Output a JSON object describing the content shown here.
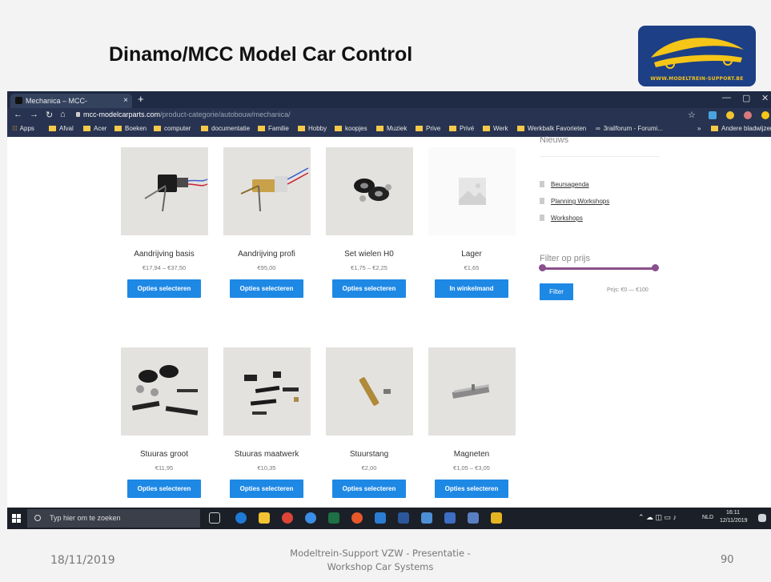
{
  "slide": {
    "title": "Dinamo/MCC Model Car Control",
    "logo_text": "WWW.MODELTREIN-SUPPORT.BE",
    "footer_date": "18/11/2019",
    "footer_center": "Modeltrein-Support  VZW - Presentatie - Workshop  Car Systems",
    "page_number": "90"
  },
  "browser": {
    "tab_title": "Mechanica – MCC-modelcarparts",
    "tab_close": "×",
    "new_tab": "+",
    "url_host": "mcc-modelcarparts.com",
    "url_path": "/product-categorie/autobouw/mechanica/",
    "bookmarks": [
      "Apps",
      "Afval",
      "Acer",
      "Boeken",
      "computer",
      "documentatie",
      "Familie",
      "Hobby",
      "koopjes",
      "Muziek",
      "Prive",
      "Privé",
      "Werk",
      "Werkbalk Favorieten",
      "3railforum - Forumi...",
      "»",
      "Andere bladwijzers"
    ]
  },
  "products": [
    {
      "name": "Aandrijving basis",
      "price": "€17,94 – €37,50",
      "button": "Opties selecteren"
    },
    {
      "name": "Aandrijving profi",
      "price": "€95,00",
      "button": "Opties selecteren"
    },
    {
      "name": "Set wielen H0",
      "price": "€1,75 – €2,25",
      "button": "Opties selecteren"
    },
    {
      "name": "Lager",
      "price": "€1,65",
      "button": "In winkelmand"
    },
    {
      "name": "Stuuras groot",
      "price": "€11,95",
      "button": "Opties selecteren"
    },
    {
      "name": "Stuuras maatwerk",
      "price": "€10,35",
      "button": "Opties selecteren"
    },
    {
      "name": "Stuurstang",
      "price": "€2,00",
      "button": "Opties selecteren"
    },
    {
      "name": "Magneten",
      "price": "€1,05 – €3,05",
      "button": "Opties selecteren"
    }
  ],
  "sidebar": {
    "news_heading": "Nieuws",
    "news_links": [
      "Beursagenda",
      "Planning Workshops",
      "Workshops"
    ],
    "filter_heading": "Filter op prijs",
    "filter_button": "Filter",
    "price_range": "Prijs: €0 — €100"
  },
  "taskbar": {
    "search_placeholder": "Typ hier om te zoeken",
    "language": "NLD",
    "time": "16:11",
    "date": "12/11/2019"
  },
  "colors": {
    "button_blue": "#1e88e5",
    "slider_purple": "#8a4f8d",
    "browser_chrome": "#1f2a44",
    "logo_blue": "#1d3f86"
  }
}
